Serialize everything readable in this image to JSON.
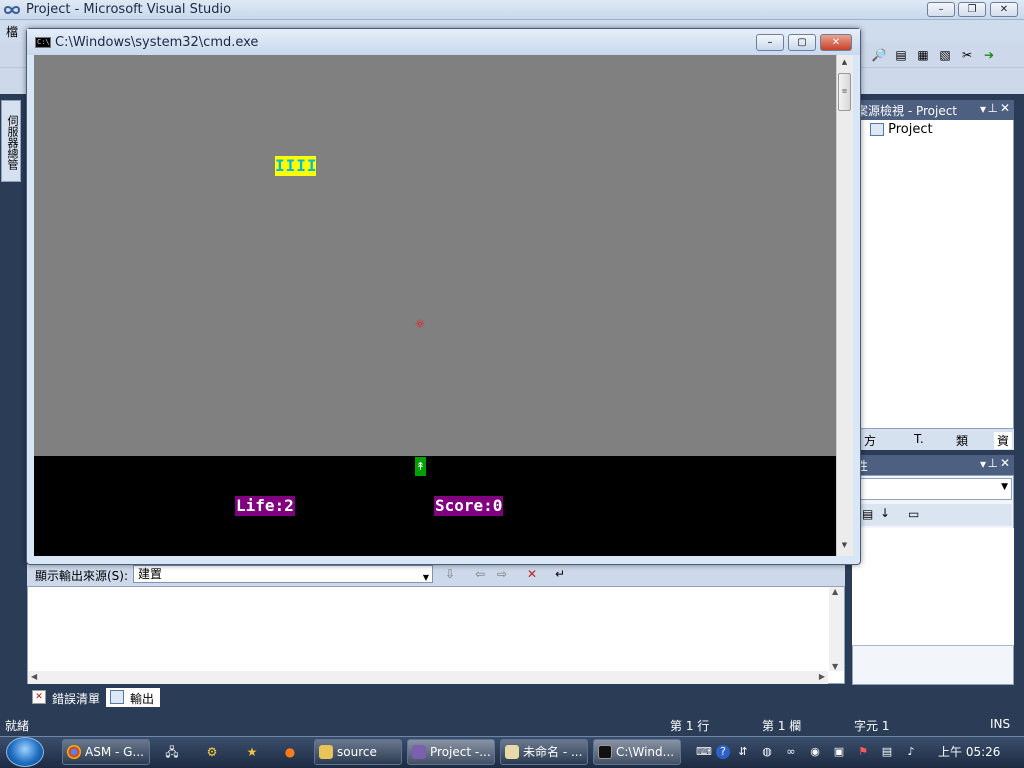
{
  "vs": {
    "title": "Project - Microsoft Visual Studio",
    "menu_first": "檔",
    "left_strip_label": "伺服器總管",
    "solution_explorer": {
      "title": "方案總管 - Project",
      "title_visible": "案源檢視 - Project",
      "root": "Project",
      "tabs": [
        "方",
        "T.",
        "類",
        "資"
      ]
    },
    "properties": {
      "title": "屬性",
      "title_visible": "性"
    },
    "output": {
      "source_label": "顯示輸出來源(S):",
      "source_value": "建置"
    },
    "bottom_tabs": [
      "錯誤清單",
      "輸出"
    ],
    "status": {
      "ready": "就緒",
      "line": "第 1 行",
      "col": "第 1 欄",
      "char": "字元 1",
      "mode": "INS"
    }
  },
  "cmd": {
    "title": "C:\\Windows\\system32\\cmd.exe",
    "icon_text": "C:\\",
    "game": {
      "enemy": "IIII",
      "bullet": "☼",
      "player": "↟",
      "life": "Life:2",
      "score": "Score:0"
    }
  },
  "taskbar": {
    "buttons": [
      {
        "label": "ASM - G...",
        "icon": "chrome-icon"
      },
      {
        "label": "source",
        "icon": "folder-icon"
      },
      {
        "label": "Project -...",
        "icon": "visual-studio-icon"
      },
      {
        "label": "未命名 - ...",
        "icon": "paint-icon"
      },
      {
        "label": "C:\\Wind...",
        "icon": "cmd-icon"
      }
    ],
    "clock": "上午 05:26"
  },
  "colors": {
    "game_bg": "#808080",
    "enemy_bg": "#ffff00",
    "enemy_fg": "#00bcd4",
    "player_bg": "#00a000",
    "hud_bg": "#800080",
    "bullet": "#ff0000"
  }
}
